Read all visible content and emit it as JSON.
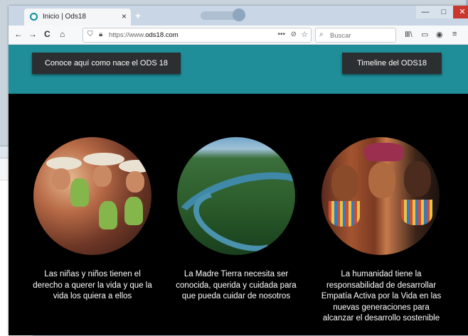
{
  "browser": {
    "tab_title": "Inicio | Ods18",
    "tab_close": "×",
    "new_tab": "+",
    "window_buttons": {
      "minimize": "—",
      "maximize": "□",
      "close": "✕"
    },
    "nav": {
      "back": "←",
      "forward": "→",
      "reload": "C",
      "home": "⌂"
    },
    "url_host_prefix": "https://www.",
    "url_host": "ods18.com",
    "url_actions": {
      "more": "•••",
      "pocket": "⊘",
      "bookmark": "☆"
    },
    "search_placeholder": "Buscar",
    "search_icon": "search-icon",
    "toolbar_icons": [
      "library-icon",
      "sidebar-icon",
      "account-icon",
      "menu-icon"
    ]
  },
  "hero": {
    "left_button": "Conoce aquí como nace el ODS 18",
    "right_button": "Timeline del ODS18"
  },
  "features": [
    {
      "caption": "Las niñas y niños tienen el derecho a querer la vida y que la vida los quiera a ellos"
    },
    {
      "caption": "La Madre Tierra necesita ser conocida, querida y cuidada para que pueda cuidar de nosotros"
    },
    {
      "caption": "La humanidad tiene la responsabilidad de desarrollar Empatía Activa por la Vida en las nuevas generaciones para alcanzar el desarrollo sostenible"
    }
  ],
  "colors": {
    "hero_bg": "#1f8e99",
    "page_bg": "#000000",
    "button_bg": "#2c2f31"
  }
}
